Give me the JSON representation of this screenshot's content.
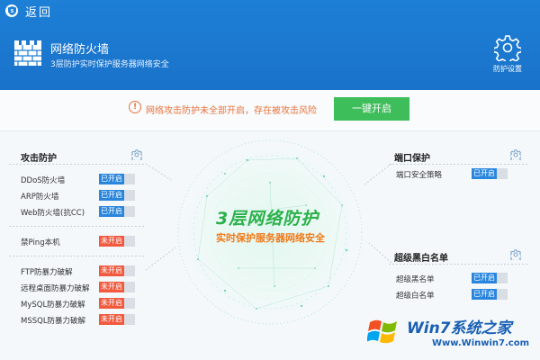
{
  "header": {
    "back_label": "返回",
    "title": "网络防火墙",
    "subtitle": "3层防护实时保护服务器网络安全",
    "settings_label": "防护设置"
  },
  "warning": {
    "text": "网络攻击防护未全部开启，存在被攻击风险",
    "button_label": "一键开启"
  },
  "status": {
    "on": "已开启",
    "off": "未开启"
  },
  "attack_protection": {
    "title": "攻击防护",
    "group1": [
      {
        "label": "DDoS防火墙",
        "state": "已开启"
      },
      {
        "label": "ARP防火墙",
        "state": "已开启"
      },
      {
        "label": "Web防火墙(抗CC)",
        "state": "已开启"
      }
    ],
    "group2": [
      {
        "label": "禁Ping本机",
        "state": "未开启"
      }
    ],
    "group3": [
      {
        "label": "FTP防暴力破解",
        "state": "未开启"
      },
      {
        "label": "远程桌面防暴力破解",
        "state": "未开启"
      },
      {
        "label": "MySQL防暴力破解",
        "state": "未开启"
      },
      {
        "label": "MSSQL防暴力破解",
        "state": "未开启"
      }
    ]
  },
  "port_protection": {
    "title": "端口保护",
    "items": [
      {
        "label": "端口安全策略",
        "state": "已开启"
      }
    ]
  },
  "blacklist": {
    "title": "超级黑白名单",
    "items": [
      {
        "label": "超级黑名单",
        "state": "已开启"
      },
      {
        "label": "超级白名单",
        "state": "已开启"
      }
    ]
  },
  "center": {
    "title": "3层网络防护",
    "subtitle": "实时保护服务器网络安全"
  },
  "watermark": {
    "brand": "Win7系统之家",
    "url": "Www.Winwin7.com"
  },
  "colors": {
    "header_blue": "#1d7fd6",
    "on_blue": "#2a86dd",
    "off_red": "#f15a3f",
    "action_green": "#3ebe5b",
    "warn_orange": "#e8733b"
  }
}
